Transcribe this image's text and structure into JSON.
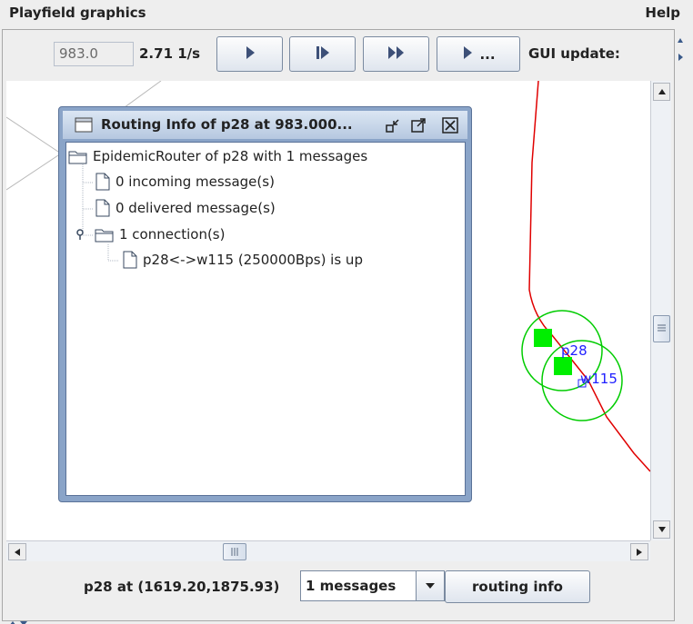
{
  "window": {
    "title": "Playfield graphics",
    "help_menu": "Help"
  },
  "toolbar": {
    "sim_time": "983.0",
    "speed": "2.71 1/s",
    "buttons": [
      {
        "name": "play-button",
        "icon": "play-icon"
      },
      {
        "name": "step-button",
        "icon": "step-icon"
      },
      {
        "name": "fast-forward-button",
        "icon": "fast-forward-icon"
      },
      {
        "name": "play-until-button",
        "icon": "play-until-icon",
        "label": "..."
      }
    ],
    "gui_update_label": "GUI update:"
  },
  "playfield": {
    "nodes": [
      {
        "label": "p28"
      },
      {
        "label": "w115"
      }
    ],
    "colors": {
      "path": "#e00000",
      "range_circle": "#00cc00",
      "node_fill": "#00ee00",
      "node_label": "#2020ff",
      "road": "#b8b8b8"
    }
  },
  "routing_window": {
    "title": "Routing Info of p28 at 983.000...",
    "tree": {
      "root": "EpidemicRouter of p28 with 1 messages",
      "children": [
        {
          "label": "0 incoming message(s)",
          "type": "leaf"
        },
        {
          "label": "0 delivered message(s)",
          "type": "leaf"
        },
        {
          "label": "1 connection(s)",
          "type": "folder",
          "children": [
            {
              "label": "p28<->w115 (250000Bps) is up"
            }
          ]
        }
      ]
    }
  },
  "status": {
    "node_info": "p28 at (1619.20,1875.93)",
    "messages_select": "1 messages",
    "routing_info_button": "routing info"
  }
}
